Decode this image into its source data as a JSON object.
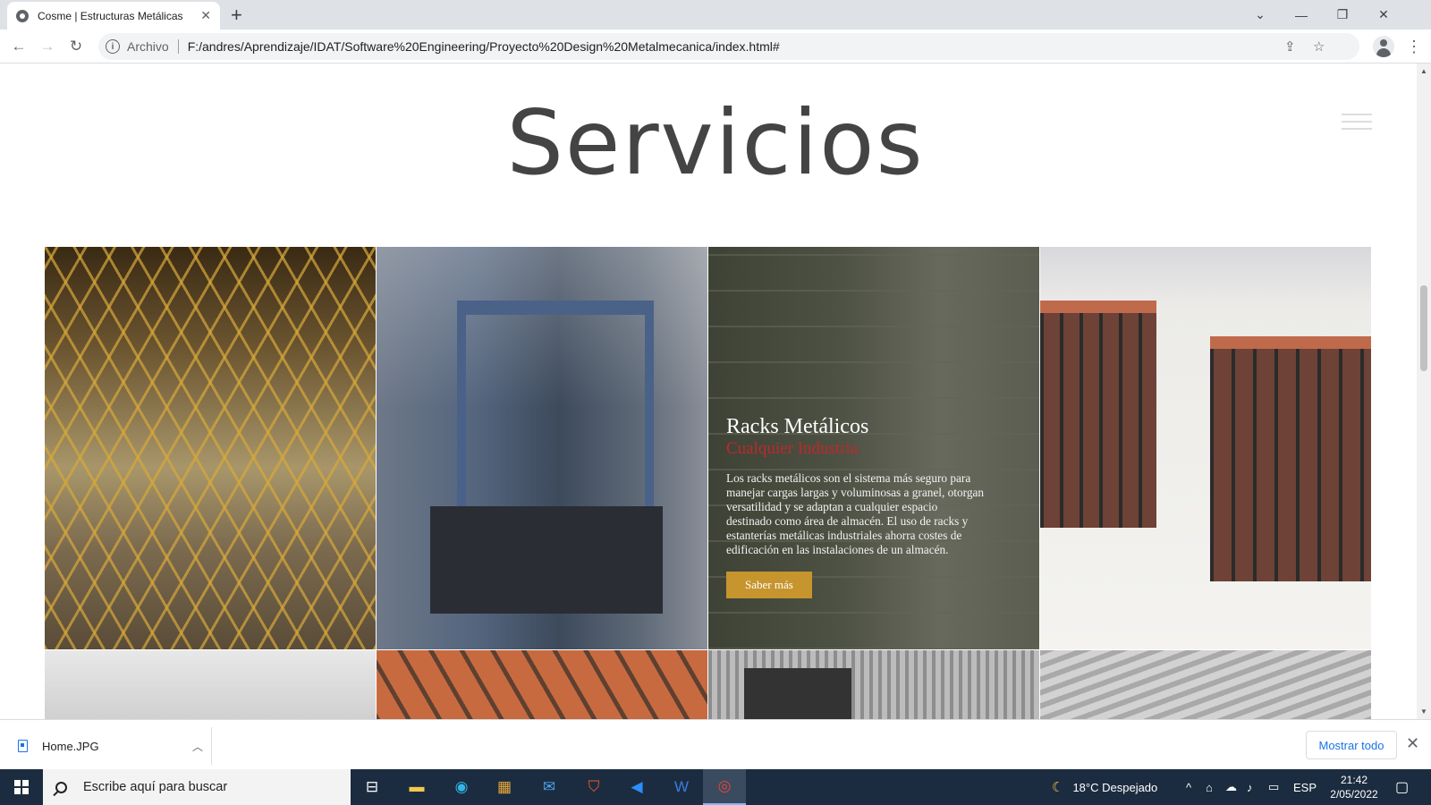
{
  "browser": {
    "tab_title": "Cosme | Estructuras Metálicas",
    "tab_close": "✕",
    "new_tab": "+",
    "protocol_label": "Archivo",
    "url": "F:/andres/Aprendizaje/IDAT/Software%20Engineering/Proyecto%20Design%20Metalmecanica/index.html#"
  },
  "page": {
    "heading": "Servicios",
    "featured_card": {
      "title": "Racks Metálicos",
      "subtitle": "Cualquier Industria",
      "description": "Los racks metálicos son el sistema más seguro para manejar cargas largas y voluminosas a granel, otorgan versatilidad y se adaptan a cualquier espacio destinado como área de almacén. El uso de racks y estanterías metálicas industriales ahorra costes de edificación en las instalaciones de un almacén.",
      "button_label": "Saber más"
    }
  },
  "downloads": {
    "file_name": "Home.JPG",
    "show_all": "Mostrar todo"
  },
  "taskbar": {
    "search_placeholder": "Escribe aquí para buscar",
    "weather": "18°C  Despejado",
    "language": "ESP",
    "time": "21:42",
    "date": "2/05/2022"
  },
  "colors": {
    "accent_button": "#c6952d",
    "subtitle_red": "#c0282a",
    "taskbar_bg": "#1c2c40"
  }
}
